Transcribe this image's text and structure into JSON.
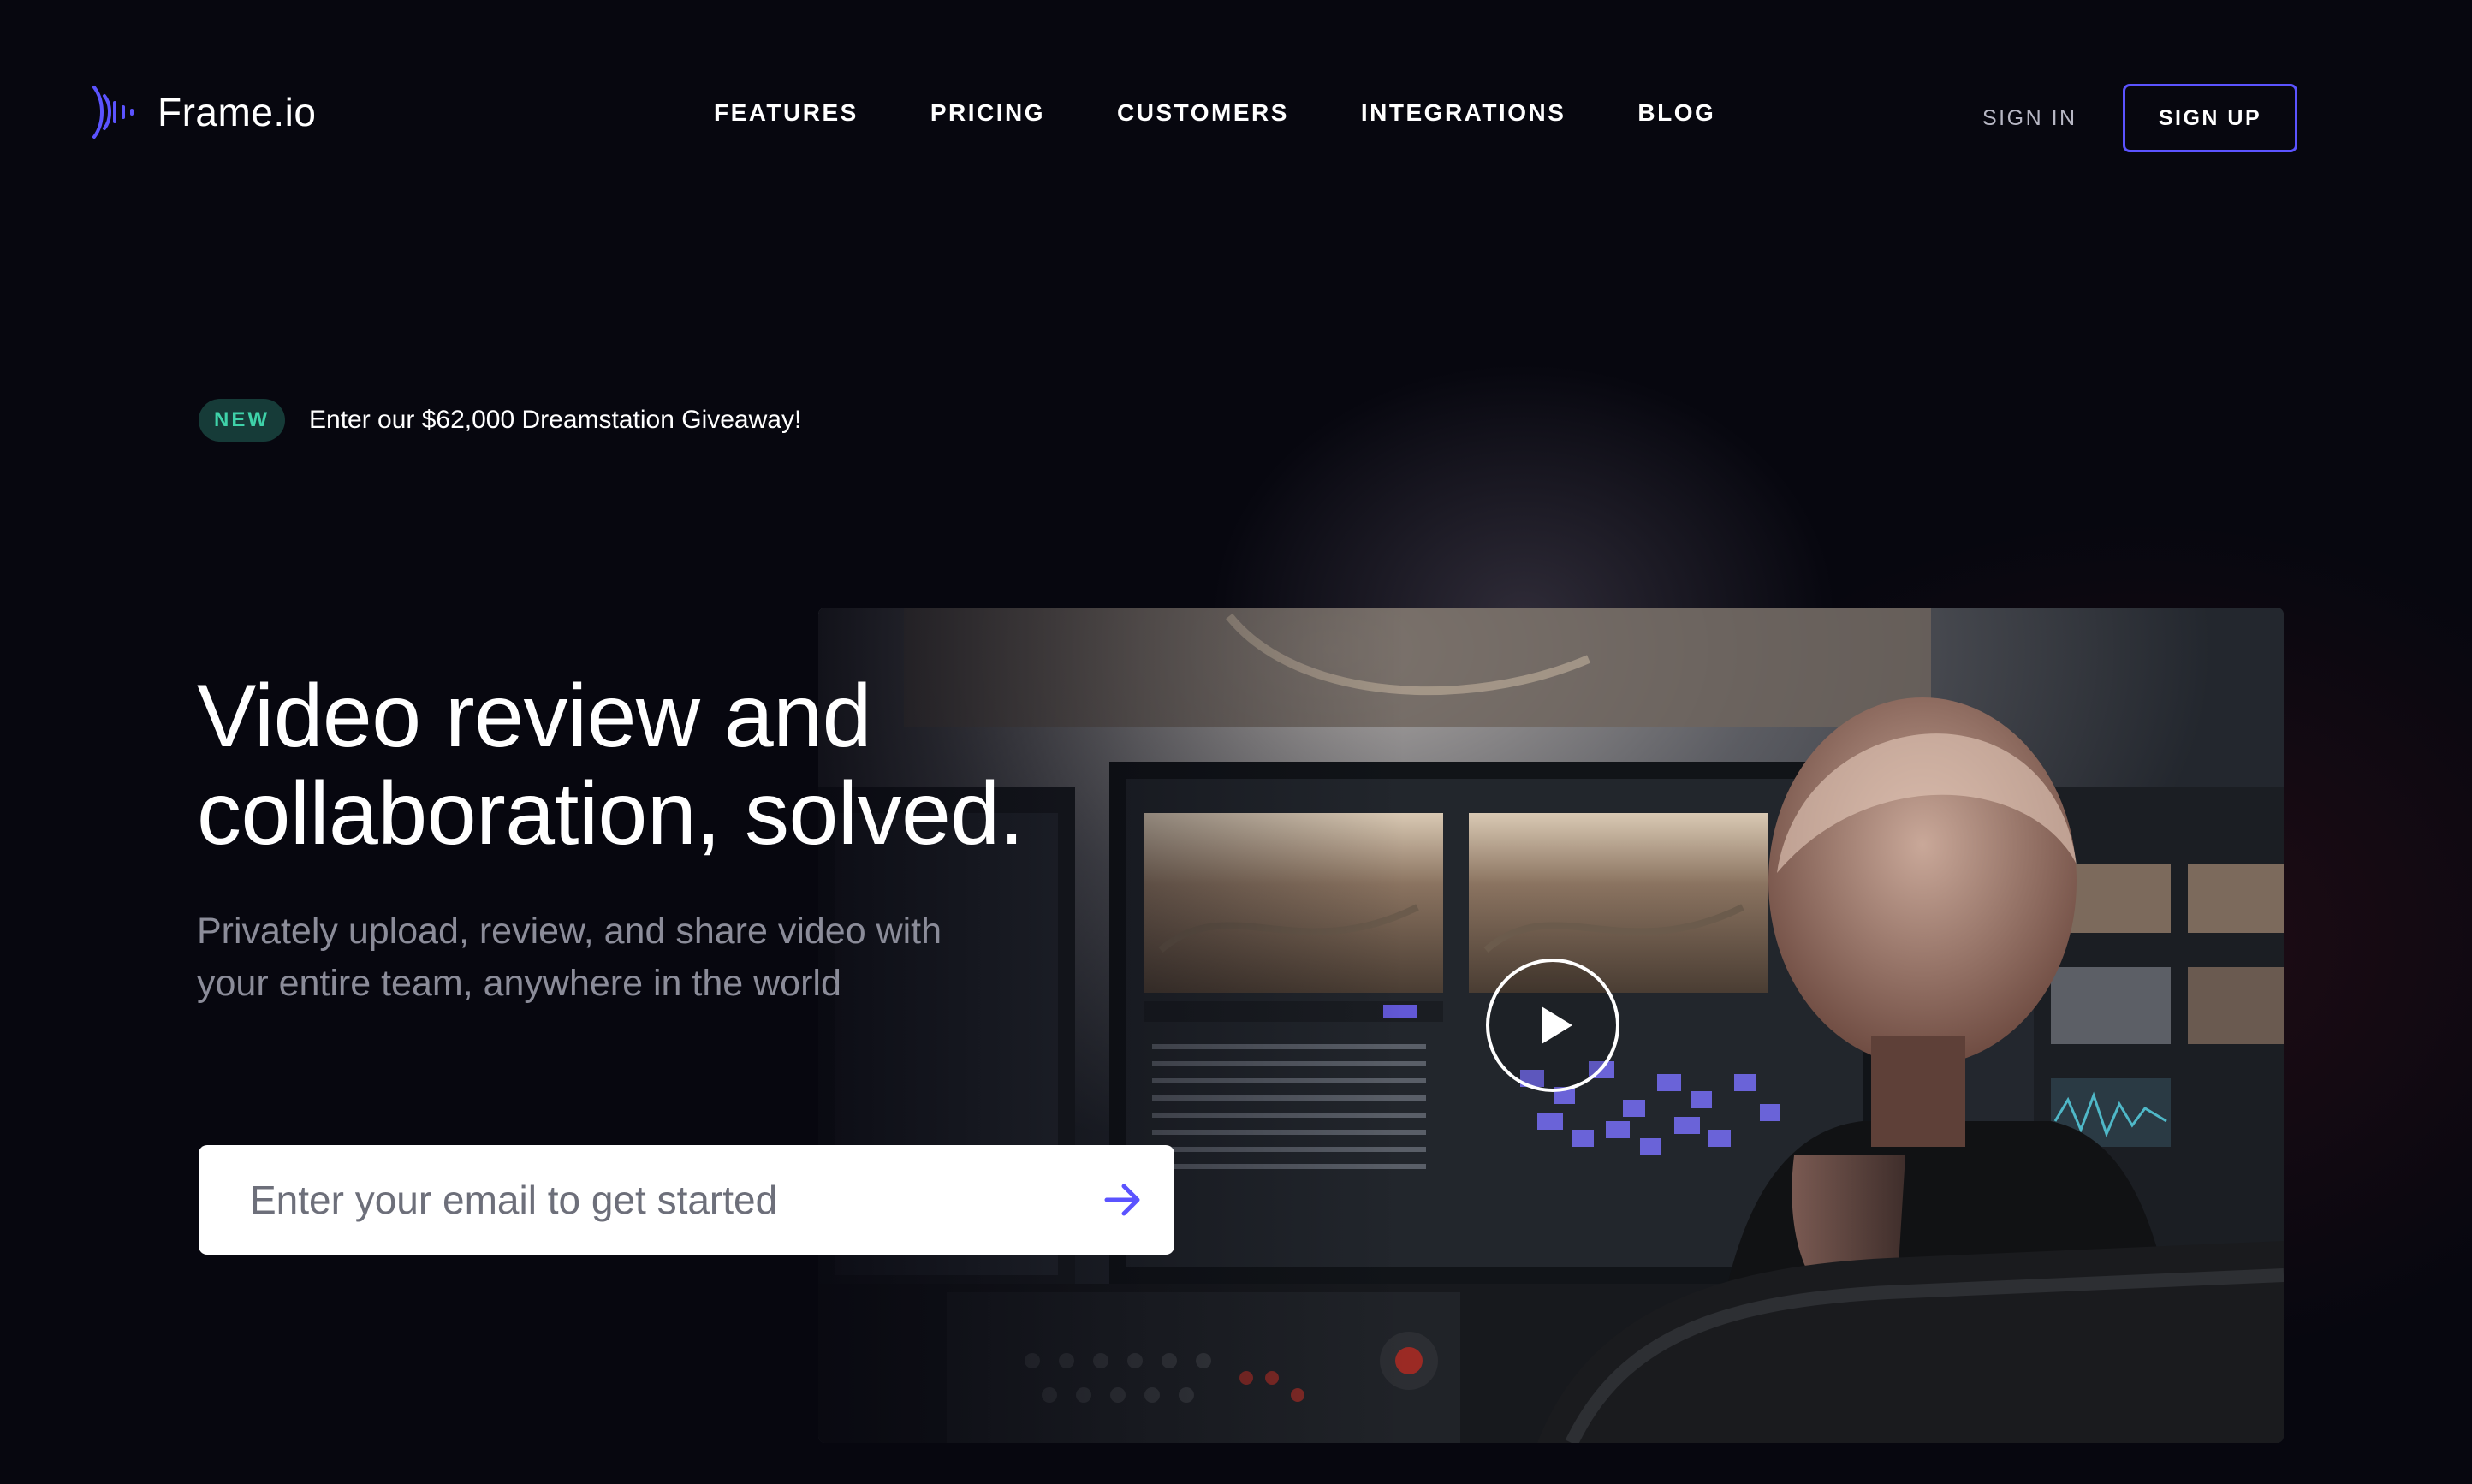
{
  "brand": {
    "name": "Frame.io",
    "accent": "#5b53ff",
    "logo_icon": "sound-wave-icon"
  },
  "nav": {
    "links": [
      "FEATURES",
      "PRICING",
      "CUSTOMERS",
      "INTEGRATIONS",
      "BLOG"
    ],
    "sign_in": "SIGN IN",
    "sign_up": "SIGN UP"
  },
  "announcement": {
    "badge": "NEW",
    "text": "Enter our $62,000 Dreamstation Giveaway!",
    "badge_color": "#3fd2a9"
  },
  "hero": {
    "title_line1": "Video review and",
    "title_line2": "collaboration, solved.",
    "subtitle_line1": "Privately upload, review, and share video with",
    "subtitle_line2": "your entire team, anywhere in the world"
  },
  "email_form": {
    "placeholder": "Enter your email to get started",
    "submit_icon": "arrow-right-icon"
  },
  "video": {
    "play_icon": "play-icon"
  }
}
